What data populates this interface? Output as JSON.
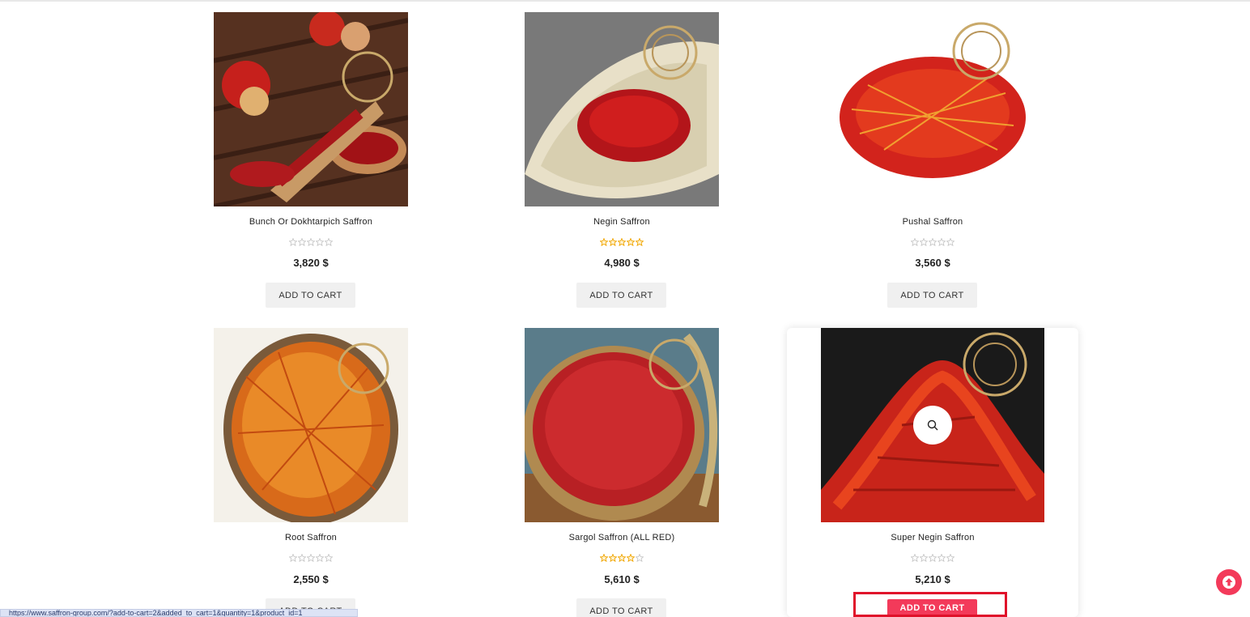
{
  "colors": {
    "accent": "#f33a5a",
    "star_filled": "#f0a500",
    "star_empty": "#c8c8c8",
    "highlight": "#e0112a"
  },
  "products": [
    {
      "title": "Bunch Or Dokhtarpich Saffron",
      "price": "3,820 $",
      "rating": 0,
      "button": "ADD TO CART"
    },
    {
      "title": "Negin Saffron",
      "price": "4,980 $",
      "rating": 5,
      "button": "ADD TO CART"
    },
    {
      "title": "Pushal Saffron",
      "price": "3,560 $",
      "rating": 0,
      "button": "ADD TO CART"
    },
    {
      "title": "Root Saffron",
      "price": "2,550 $",
      "rating": 0,
      "button": "ADD TO CART"
    },
    {
      "title": "Sargol Saffron (ALL RED)",
      "price": "5,610 $",
      "rating": 4,
      "button": "ADD TO CART"
    },
    {
      "title": "Super Negin Saffron",
      "price": "5,210 $",
      "rating": 0,
      "button": "ADD TO CART"
    }
  ],
  "icons": {
    "quick_view": "search-icon",
    "scroll_top": "arrow-up-circle-icon"
  },
  "status_bar": {
    "url": "https://www.saffron-group.com/?add-to-cart=2&added_to_cart=1&quantity=1&product_id=1"
  }
}
